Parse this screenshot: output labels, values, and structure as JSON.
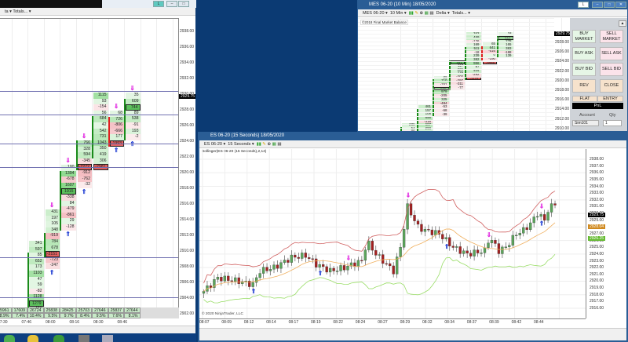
{
  "left_window": {
    "toolbar": {
      "delta_label": "ta",
      "totals_label": "Totals..."
    },
    "axis_labels": [
      "2938.00",
      "2936.00",
      "2934.00",
      "2932.00",
      "2930.00",
      "2928.00",
      "2926.00",
      "2924.00",
      "2922.00",
      "2920.00",
      "2918.00",
      "2916.00",
      "2914.00",
      "2912.00",
      "2910.00",
      "2908.00",
      "2906.00",
      "2904.00",
      "2902.00"
    ],
    "last_price": "2929.75",
    "level_lines": [
      2930.5,
      2927.5,
      2923.8,
      2920.8,
      2909.3,
      2904.2
    ],
    "bars": [
      {
        "col": 2,
        "top": 2911.4,
        "dir": "up",
        "body": [
          2,
          11
        ],
        "cells": [
          "341",
          "597",
          "85",
          "652",
          "173",
          "1103",
          "47",
          "59",
          "-82",
          "1128",
          "1279",
          "491"
        ],
        "boxed": [
          10
        ]
      },
      {
        "col": 3,
        "top": 2915.4,
        "dir": "up",
        "body": [
          4,
          7
        ],
        "cells": [
          "431",
          "197",
          "105",
          "348",
          "-919",
          "784",
          "678",
          "-2151",
          "-723",
          "-247"
        ],
        "boxed": [
          7
        ],
        "down_arrow": true,
        "up_arrow": true
      },
      {
        "col": 4,
        "top": 2921.1,
        "dir": "up",
        "body": [
          1,
          10
        ],
        "cells": [
          "100",
          "1394",
          "-678",
          "1607",
          "1915",
          "-338",
          "84",
          "-479",
          "-861",
          "29",
          "-128"
        ],
        "boxed": [
          4
        ],
        "down_arrow": true,
        "up_arrow": true
      },
      {
        "col": 5,
        "top": 2924.2,
        "dir": "up",
        "body": [
          0,
          4
        ],
        "cells": [
          "766",
          "328",
          "594",
          "-345",
          "-2272",
          "-912",
          "-762",
          "-32"
        ],
        "boxed": [
          4
        ],
        "down_arrow": true,
        "up_arrow": true
      },
      {
        "col": 6,
        "top": 2930.3,
        "dir": "up",
        "body": [
          4,
          10
        ],
        "cells": [
          "1115",
          "93",
          "-154",
          "56",
          "684",
          "42",
          "542",
          "731",
          "1043",
          "350",
          "419",
          "306",
          "-2981"
        ],
        "boxed": [
          12
        ]
      },
      {
        "col": 7,
        "top": 2928.0,
        "dir": "down",
        "body": [
          1,
          5
        ],
        "cells": [
          "68",
          "726",
          "-806",
          "-666",
          "177",
          "-1993"
        ],
        "boxed": [
          5
        ],
        "down_arrow": true,
        "up_arrow": true
      },
      {
        "col": 8,
        "top": 2930.3,
        "dir": "up",
        "body": [
          1,
          7
        ],
        "cells": [
          "35",
          "609",
          "744",
          "89",
          "538",
          "-91",
          "193",
          "-2"
        ],
        "boxed": [
          2
        ],
        "down_arrow": true,
        "up_arrow": true
      }
    ],
    "totals": [
      "5961",
      "17609",
      "26724",
      "25838",
      "28425",
      "25703",
      "27646",
      "25837",
      "27644"
    ],
    "percents": [
      "8.9%",
      "7.4%",
      "10.4%",
      "9.5%",
      "9.7%",
      "8.4%",
      "9.5%",
      "7.6%",
      "8.1%"
    ],
    "times": [
      "07:30",
      "07:46",
      "08:00",
      "08:16",
      "08:30",
      "08:46"
    ]
  },
  "mes_window": {
    "title": "MES 06-20 (10 Min)  18/05/2020",
    "toolbar": {
      "instrument": "MES 06-20 ▾",
      "interval": "10 Min ▾",
      "delta": "Delta ▾",
      "totals": "Totals... ▾"
    },
    "indicator_label": "©2018 Final Market Balance",
    "axis_labels": [
      "2928.00",
      "2926.00",
      "2924.00",
      "2922.00",
      "2920.00",
      "2918.00",
      "2916.00",
      "2914.00",
      "2912.00",
      "2910.00"
    ],
    "last_price": "2929.75",
    "bars": [
      {
        "col": 0,
        "top": 2911.1,
        "dir": "up",
        "body": [
          1,
          2
        ],
        "cells": [
          "236",
          "54",
          "-26"
        ],
        "boxed": []
      },
      {
        "col": 1,
        "top": 2914.9,
        "dir": "up",
        "body": [
          1,
          7
        ],
        "cells": [
          "461",
          "157",
          "108",
          "656",
          "-318",
          "687",
          "298",
          "-1065"
        ],
        "boxed": [
          7
        ]
      },
      {
        "col": 2,
        "top": 2921.0,
        "dir": "up",
        "body": [
          1,
          10
        ],
        "cells": [
          "26",
          "710",
          "-151",
          "939",
          "979",
          "-205",
          "325",
          "-484",
          "-53",
          "-68",
          "-39"
        ],
        "boxed": [
          3
        ]
      },
      {
        "col": 3,
        "top": 2924.2,
        "dir": "up",
        "body": [
          0,
          7
        ],
        "cells": [
          "441",
          "117",
          "226",
          "229",
          "-202",
          "-297",
          "-311",
          "-77"
        ],
        "boxed": [
          0
        ]
      },
      {
        "col": 4,
        "top": 2930.1,
        "dir": "up",
        "body": [
          4,
          12
        ],
        "cells": [
          "342",
          "469",
          "-126",
          "169",
          "511",
          "-18",
          "239",
          "382",
          "956",
          "87",
          "404",
          "-292",
          "-1177"
        ],
        "boxed": [
          12
        ]
      },
      {
        "col": 5,
        "top": 2928.0,
        "dir": "down",
        "body": [
          1,
          4
        ],
        "cells": [
          "65",
          "641",
          "-516",
          "0",
          "-190",
          "-2059"
        ],
        "boxed": [
          5
        ]
      },
      {
        "col": 6,
        "top": 2930.1,
        "dir": "up",
        "body": [
          1,
          6
        ],
        "cells": [
          "18",
          "514",
          "278",
          "165",
          "383",
          "-188",
          "139"
        ],
        "boxed": [
          1
        ]
      }
    ],
    "chart_trader": {
      "buy_market": "BUY MARKET",
      "sell_market": "SELL MARKET",
      "buy_ask": "BUY ASK",
      "sell_ask": "SELL ASK",
      "buy_bid": "BUY BID",
      "sell_bid": "SELL BID",
      "rev": "REV",
      "close": "CLOSE",
      "flat": "FLAT",
      "entry": "ENTRY",
      "pnl": "PnL",
      "account_label": "Account",
      "account_value": "Sim101",
      "qty_label": "Qty",
      "qty_value": "1"
    }
  },
  "es_window": {
    "title": "ES 06-20 (15 Seconds)  18/05/2020",
    "toolbar": {
      "instrument": "ES 06-20 ▾",
      "interval": "15 Seconds ▾"
    },
    "indicator_label": "Bollinger(ES 06-20 (15 Seconds),2,14)",
    "copyright": "© 2020 NinjaTrader, LLC",
    "axis_labels": [
      "2938.00",
      "2937.00",
      "2936.00",
      "2935.00",
      "2934.00",
      "2933.00",
      "2932.00",
      "2931.00",
      "2930.00",
      "2929.00",
      "2928.00",
      "2927.00",
      "2926.00",
      "2925.00",
      "2924.00",
      "2923.00",
      "2922.00",
      "2921.00",
      "2920.00",
      "2919.00",
      "2918.00",
      "2917.00",
      "2916.00"
    ],
    "tags": {
      "last": "2929.75",
      "upper": "2928.04",
      "lower": "2926.25"
    },
    "times": [
      "08:07",
      "08:09",
      "08:12",
      "08:14",
      "08:17",
      "08:19",
      "08:22",
      "08:24",
      "08:27",
      "08:29",
      "08:32",
      "08:34",
      "08:37",
      "08:39",
      "08:42",
      "08:44"
    ]
  },
  "chart_data": {
    "type": "candlestick",
    "title": "ES 06-20 (15 Seconds)",
    "ylim": [
      2916,
      2938
    ],
    "bollinger": {
      "std": 2,
      "period": 14
    },
    "close_anchors": [
      [
        0,
        2918.5
      ],
      [
        4,
        2920.5
      ],
      [
        10,
        2920
      ],
      [
        14,
        2919.5
      ],
      [
        16,
        2921.5
      ],
      [
        20,
        2922
      ],
      [
        25,
        2923.5
      ],
      [
        29,
        2923.8
      ],
      [
        32,
        2922.5
      ],
      [
        36,
        2921.5
      ],
      [
        40,
        2922
      ],
      [
        45,
        2923
      ],
      [
        46,
        2925
      ],
      [
        47,
        2925.5
      ],
      [
        49,
        2924
      ],
      [
        54,
        2921.5
      ],
      [
        56,
        2925
      ],
      [
        58,
        2931
      ],
      [
        59,
        2930
      ],
      [
        61,
        2928
      ],
      [
        63,
        2927.5
      ],
      [
        67,
        2927
      ],
      [
        69,
        2926
      ],
      [
        71,
        2925
      ],
      [
        73,
        2924.5
      ],
      [
        75,
        2924
      ],
      [
        80,
        2924.5
      ],
      [
        81,
        2926
      ],
      [
        82,
        2926
      ],
      [
        84,
        2924.5
      ],
      [
        86,
        2925
      ],
      [
        89,
        2927
      ],
      [
        91,
        2927.5
      ],
      [
        93,
        2928.5
      ],
      [
        95,
        2930
      ],
      [
        97,
        2929
      ],
      [
        98,
        2930.5
      ],
      [
        100,
        2931.5
      ]
    ],
    "colors": {
      "up": "#5aa55a",
      "down": "#a52020",
      "upper": "#d06060",
      "mid": "#f0b060",
      "lower": "#99dd66"
    }
  }
}
